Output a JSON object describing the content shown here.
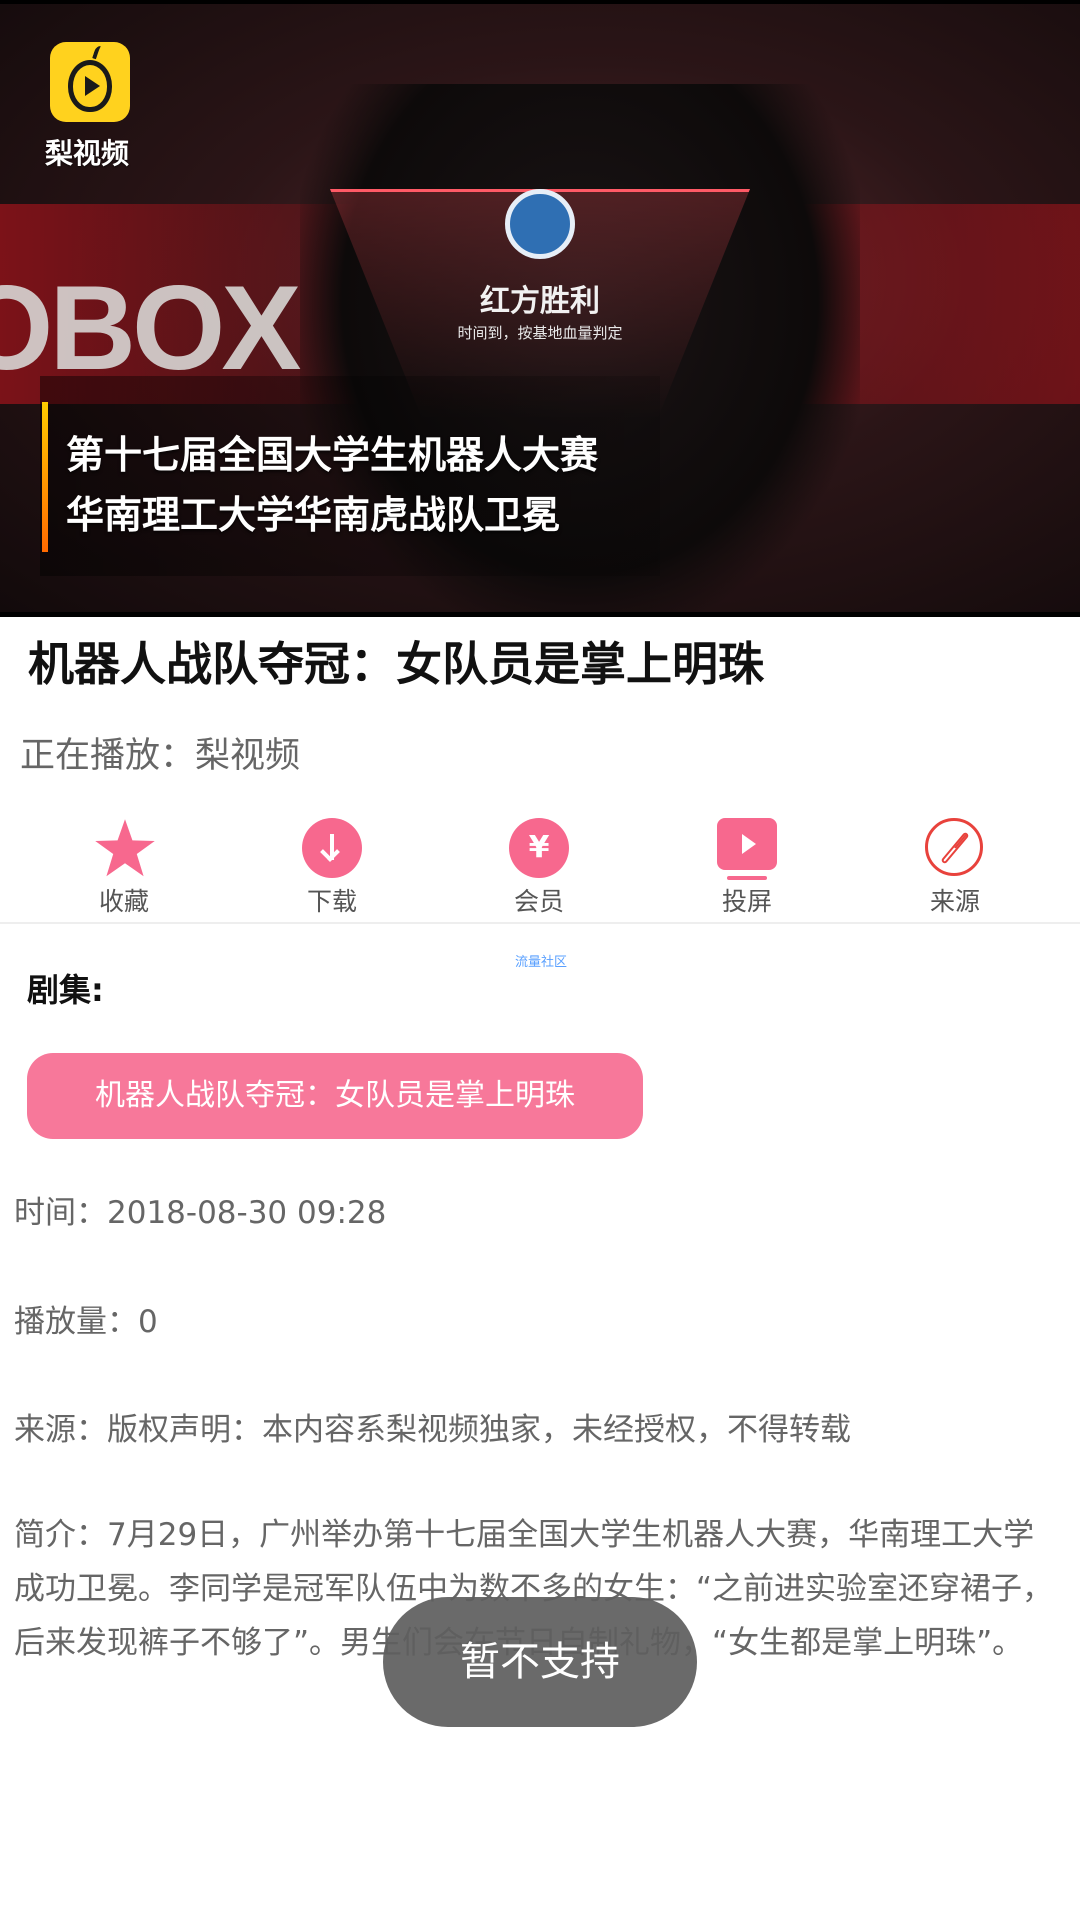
{
  "player": {
    "logo_text": "梨视频",
    "overlay_title": "红方胜利",
    "overlay_subtitle": "时间到，按基地血量判定",
    "bg_text": "OBOX",
    "caption_line1": "第十七届全国大学生机器人大赛",
    "caption_line2": "华南理工大学华南虎战队卫冕"
  },
  "info": {
    "title": "机器人战队夺冠：女队员是掌上明珠",
    "now_playing": "正在播放：梨视频"
  },
  "actions": [
    {
      "label": "收藏",
      "icon": "star-icon"
    },
    {
      "label": "下载",
      "icon": "download-icon"
    },
    {
      "label": "会员",
      "icon": "yen-icon",
      "glyph": "¥"
    },
    {
      "label": "投屏",
      "icon": "cast-screen-icon"
    },
    {
      "label": "来源",
      "icon": "compass-icon"
    }
  ],
  "watermark": "流量社区",
  "episodes": {
    "label": "剧集:",
    "items": [
      "机器人战队夺冠：女队员是掌上明珠"
    ]
  },
  "meta": {
    "time": "时间：2018-08-30 09:28",
    "views": "播放量：0",
    "source": "来源：版权声明：本内容系梨视频独家，未经授权，不得转载",
    "description": "简介：7月29日，广州举办第十七届全国大学生机器人大赛，华南理工大学成功卫冕。李同学是冠军队伍中为数不多的女生：“之前进实验室还穿裙子，后来发现裤子不够了”。男生们会在节日自制礼物，“女生都是掌上明珠”。"
  },
  "toast": "暂不支持",
  "colors": {
    "accent_pink": "#f7688e",
    "compass_red": "#e8423c",
    "logo_yellow": "#ffd21e"
  }
}
